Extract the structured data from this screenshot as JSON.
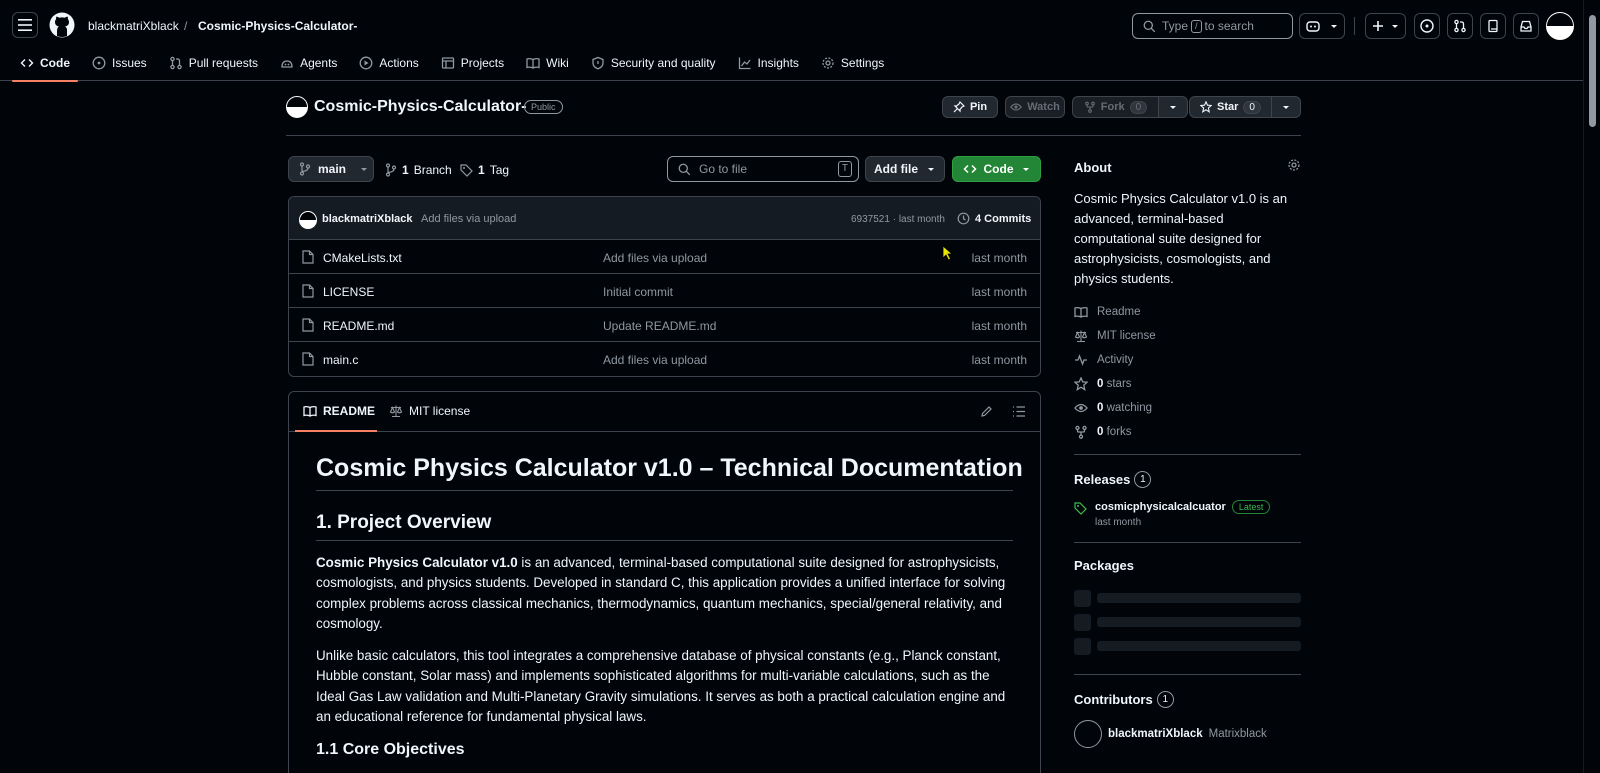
{
  "header": {
    "owner": "blackmatriXblack",
    "separator": "/",
    "repo": "Cosmic-Physics-Calculator-",
    "search_before": "Type",
    "search_key": "/",
    "search_after": "to search"
  },
  "tabs": [
    {
      "label": "Code",
      "icon": "code-icon"
    },
    {
      "label": "Issues",
      "icon": "issue-icon"
    },
    {
      "label": "Pull requests",
      "icon": "pull-request-icon"
    },
    {
      "label": "Agents",
      "icon": "agent-icon"
    },
    {
      "label": "Actions",
      "icon": "play-icon"
    },
    {
      "label": "Projects",
      "icon": "table-icon"
    },
    {
      "label": "Wiki",
      "icon": "book-icon"
    },
    {
      "label": "Security and quality",
      "icon": "shield-icon"
    },
    {
      "label": "Insights",
      "icon": "graph-icon"
    },
    {
      "label": "Settings",
      "icon": "gear-icon"
    }
  ],
  "repo": {
    "title": "Cosmic-Physics-Calculator-",
    "visibility": "Public",
    "pin": "Pin",
    "watch": "Watch",
    "fork": "Fork",
    "fork_count": "0",
    "star": "Star",
    "star_count": "0"
  },
  "filenav": {
    "branch": "main",
    "branches_count": "1",
    "branches_label": "Branch",
    "tags_count": "1",
    "tags_label": "Tag",
    "goto_placeholder": "Go to file",
    "goto_key": "T",
    "add_file": "Add file",
    "code": "Code"
  },
  "commit": {
    "user": "blackmatriXblack",
    "message": "Add files via upload",
    "hash_time": "6937521 · last month",
    "commits": "4 Commits"
  },
  "files": [
    {
      "name": "CMakeLists.txt",
      "message": "Add files via upload",
      "date": "last month"
    },
    {
      "name": "LICENSE",
      "message": "Initial commit",
      "date": "last month"
    },
    {
      "name": "README.md",
      "message": "Update README.md",
      "date": "last month"
    },
    {
      "name": "main.c",
      "message": "Add files via upload",
      "date": "last month"
    }
  ],
  "readme": {
    "tab_readme": "README",
    "tab_license": "MIT license",
    "h1": "Cosmic Physics Calculator v1.0 – Technical Documentation",
    "h2": "1. Project Overview",
    "p1_bold": "Cosmic Physics Calculator v1.0",
    "p1_rest": " is an advanced, terminal-based computational suite designed for astrophysicists, cosmologists, and physics students. Developed in standard C, this application provides a unified interface for solving complex problems across classical mechanics, thermodynamics, quantum mechanics, special/general relativity, and cosmology.",
    "p2": "Unlike basic calculators, this tool integrates a comprehensive database of physical constants (e.g., Planck constant, Hubble constant, Solar mass) and implements sophisticated algorithms for multi-variable calculations, such as the Ideal Gas Law validation and Multi-Planetary Gravity simulations. It serves as both a practical calculation engine and an educational reference for fundamental physical laws.",
    "h3": "1.1 Core Objectives"
  },
  "about": {
    "title": "About",
    "description": "Cosmic Physics Calculator v1.0 is an advanced, terminal-based computational suite designed for astrophysicists, cosmologists, and physics students.",
    "items": [
      {
        "icon": "book-icon",
        "bold": "",
        "text": "Readme"
      },
      {
        "icon": "law-icon",
        "bold": "",
        "text": "MIT license"
      },
      {
        "icon": "pulse-icon",
        "bold": "",
        "text": "Activity"
      },
      {
        "icon": "star-icon",
        "bold": "0",
        "text": "stars"
      },
      {
        "icon": "eye-icon",
        "bold": "0",
        "text": "watching"
      },
      {
        "icon": "fork-icon",
        "bold": "0",
        "text": "forks"
      }
    ]
  },
  "releases": {
    "title": "Releases",
    "count": "1",
    "name": "cosmicphysicalcalcuator",
    "latest": "Latest",
    "date": "last month"
  },
  "packages": {
    "title": "Packages"
  },
  "contributors": {
    "title": "Contributors",
    "count": "1",
    "user": "blackmatriXblack",
    "name": "Matrixblack"
  },
  "colors": {
    "background": "#010409",
    "border": "#3d444d",
    "muted": "#9198a1",
    "accent_tab": "#f78166",
    "green": "#238636"
  }
}
